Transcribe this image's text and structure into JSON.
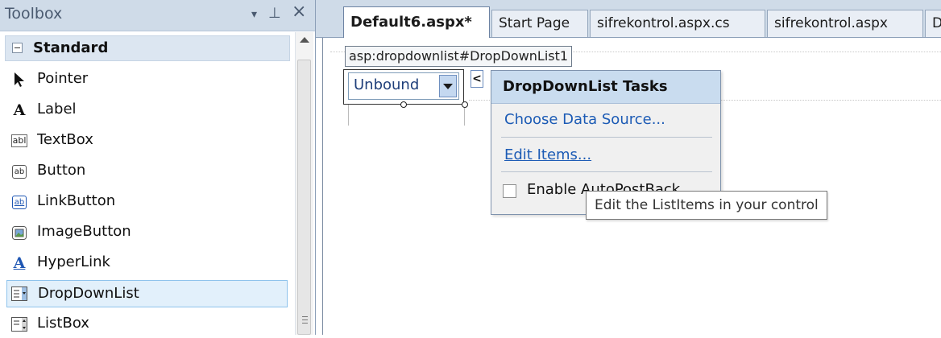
{
  "toolbox": {
    "title": "Toolbox",
    "controls": {
      "dropdown": "▾",
      "pin": "⊥",
      "close": "×"
    },
    "group": {
      "label": "Standard"
    },
    "items": [
      {
        "label": "Pointer",
        "icon": "pointer-icon"
      },
      {
        "label": "Label",
        "icon": "label-icon"
      },
      {
        "label": "TextBox",
        "icon": "textbox-icon",
        "glyph": "abl"
      },
      {
        "label": "Button",
        "icon": "button-icon",
        "glyph": "ab"
      },
      {
        "label": "LinkButton",
        "icon": "linkbutton-icon",
        "glyph": "ab"
      },
      {
        "label": "ImageButton",
        "icon": "imagebutton-icon"
      },
      {
        "label": "HyperLink",
        "icon": "hyperlink-icon"
      },
      {
        "label": "DropDownList",
        "icon": "dropdownlist-icon",
        "selected": true
      },
      {
        "label": "ListBox",
        "icon": "listbox-icon"
      }
    ]
  },
  "tabs": [
    {
      "label": "Default6.aspx*",
      "active": true
    },
    {
      "label": "Start Page"
    },
    {
      "label": "sifrekontrol.aspx.cs"
    },
    {
      "label": "sifrekontrol.aspx"
    },
    {
      "label": "D"
    }
  ],
  "designer": {
    "control_tag": "asp:dropdownlist#DropDownList1",
    "dropdown_value": "Unbound",
    "smart_tag_glyph": "<"
  },
  "tasks_panel": {
    "title": "DropDownList Tasks",
    "choose_data_source": "Choose Data Source...",
    "edit_items": "Edit Items...",
    "enable_autopostback": "Enable AutoPostBack",
    "autopostback_checked": false
  },
  "tooltip": {
    "text": "Edit the ListItems in your control"
  },
  "colors": {
    "panel_header": "#cfdbe8",
    "link": "#1c5bb5",
    "selection_bg": "#e2f0fb",
    "selection_border": "#8fc3ec",
    "tasks_header": "#c9dcef"
  }
}
